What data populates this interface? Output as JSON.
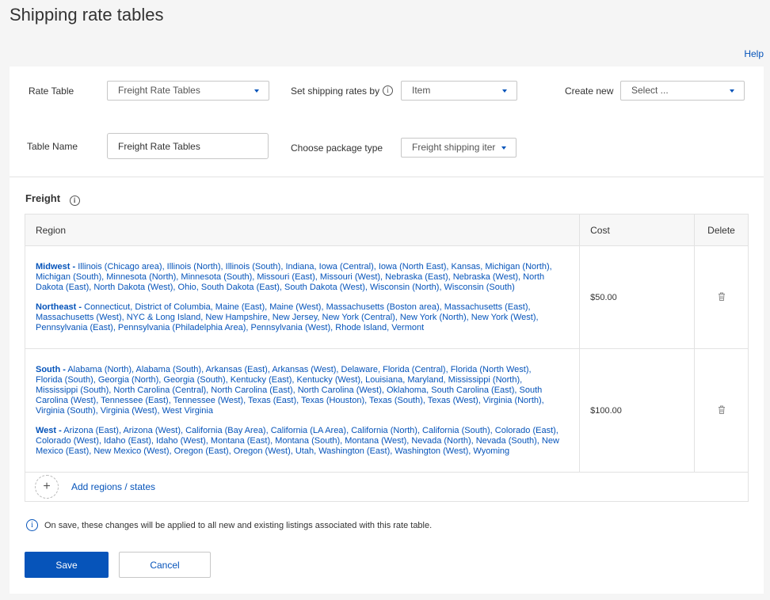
{
  "page": {
    "title": "Shipping rate tables",
    "help": "Help"
  },
  "form": {
    "rate_table_label": "Rate Table",
    "rate_table_value": "Freight Rate Tables",
    "rates_by_label": "Set shipping rates by",
    "rates_by_value": "Item",
    "create_new_label": "Create new",
    "create_new_value": "Select ...",
    "table_name_label": "Table Name",
    "table_name_value": "Freight Rate Tables",
    "package_type_label": "Choose package type",
    "package_type_value": "Freight shipping iter"
  },
  "section": {
    "title": "Freight"
  },
  "table": {
    "headers": {
      "region": "Region",
      "cost": "Cost",
      "delete": "Delete"
    },
    "rows": [
      {
        "cost": "$50.00",
        "groups": [
          {
            "name": "Midwest -",
            "states": "Illinois (Chicago area), Illinois (North), Illinois (South), Indiana, Iowa (Central), Iowa (North East), Kansas, Michigan (North), Michigan (South), Minnesota (North), Minnesota (South), Missouri (East), Missouri (West), Nebraska (East), Nebraska (West), North Dakota (East), North Dakota (West), Ohio, South Dakota (East), South Dakota (West), Wisconsin (North), Wisconsin (South)"
          },
          {
            "name": "Northeast -",
            "states": "Connecticut, District of Columbia, Maine (East), Maine (West), Massachusetts (Boston area), Massachusetts (East), Massachusetts (West), NYC & Long Island, New Hampshire, New Jersey, New York (Central), New York (North), New York (West), Pennsylvania (East), Pennsylvania (Philadelphia Area), Pennsylvania (West), Rhode Island, Vermont"
          }
        ]
      },
      {
        "cost": "$100.00",
        "groups": [
          {
            "name": "South -",
            "states": "Alabama (North), Alabama (South), Arkansas (East), Arkansas (West), Delaware, Florida (Central), Florida (North West), Florida (South), Georgia (North), Georgia (South), Kentucky (East), Kentucky (West), Louisiana, Maryland, Mississippi (North), Mississippi (South), North Carolina (Central), North Carolina (East), North Carolina (West), Oklahoma, South Carolina (East), South Carolina (West), Tennessee (East), Tennessee (West), Texas (East), Texas (Houston), Texas (South), Texas (West), Virginia (North), Virginia (South), Virginia (West), West Virginia"
          },
          {
            "name": "West -",
            "states": "Arizona (East), Arizona (West), California (Bay Area), California (LA Area), California (North), California (South), Colorado (East), Colorado (West), Idaho (East), Idaho (West), Montana (East), Montana (South), Montana (West), Nevada (North), Nevada (South), New Mexico (East), New Mexico (West), Oregon (East), Oregon (West), Utah, Washington (East), Washington (West), Wyoming"
          }
        ]
      }
    ],
    "add_label": "Add regions / states"
  },
  "notice": "On save, these changes will be applied to all new and existing listings associated with this rate table.",
  "buttons": {
    "save": "Save",
    "cancel": "Cancel"
  },
  "icons": {
    "info": "info-icon",
    "trash": "trash-icon",
    "plus": "plus-icon",
    "caret": "caret-down-icon"
  },
  "colors": {
    "accent": "#0654ba",
    "background": "#f5f5f5",
    "border": "#e2e2e2"
  }
}
